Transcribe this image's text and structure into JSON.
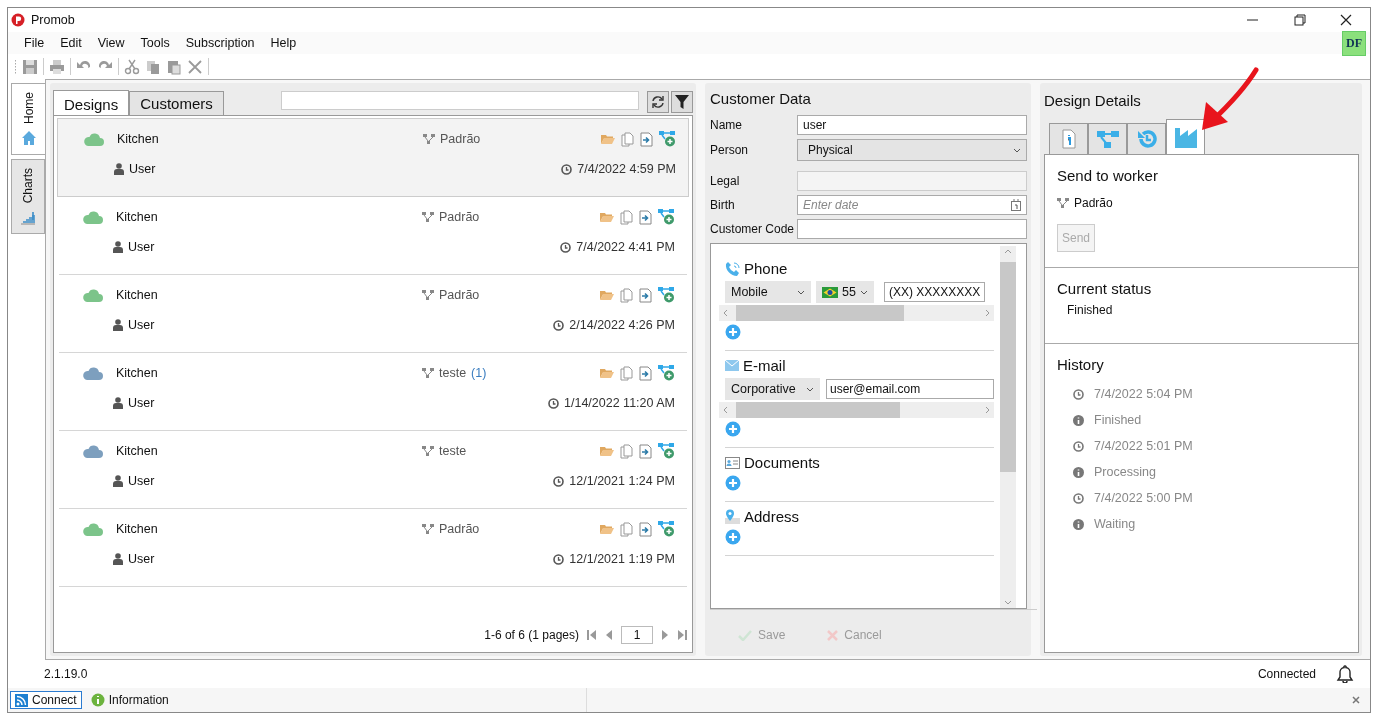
{
  "window": {
    "title": "Promob",
    "user_badge": "DF"
  },
  "menu": [
    {
      "label": "File"
    },
    {
      "label": "Edit"
    },
    {
      "label": "View"
    },
    {
      "label": "Tools"
    },
    {
      "label": "Subscription"
    },
    {
      "label": "Help"
    }
  ],
  "side_tabs": [
    {
      "label": "Home",
      "kind": "home",
      "selected": true
    },
    {
      "label": "Charts",
      "kind": "charts",
      "selected": false
    }
  ],
  "designs_panel": {
    "tabs": [
      {
        "label": "Designs",
        "selected": true
      },
      {
        "label": "Customers",
        "selected": false
      }
    ],
    "rows": [
      {
        "name": "Kitchen",
        "user": "User",
        "workflow": "Padrão",
        "date": "7/4/2022 4:59 PM",
        "color": "#7cc48a",
        "selected": true
      },
      {
        "name": "Kitchen",
        "user": "User",
        "workflow": "Padrão",
        "date": "7/4/2022 4:41 PM",
        "color": "#7cc48a",
        "selected": false
      },
      {
        "name": "Kitchen",
        "user": "User",
        "workflow": "Padrão",
        "date": "2/14/2022 4:26 PM",
        "color": "#7cc48a",
        "selected": false
      },
      {
        "name": "Kitchen",
        "user": "User",
        "workflow": "teste",
        "workflow_count": "(1)",
        "date": "1/14/2022 11:20 AM",
        "color": "#7d9fbe",
        "selected": false
      },
      {
        "name": "Kitchen",
        "user": "User",
        "workflow": "teste",
        "date": "12/1/2021 1:24 PM",
        "color": "#7d9fbe",
        "selected": false
      },
      {
        "name": "Kitchen",
        "user": "User",
        "workflow": "Padrão",
        "date": "12/1/2021 1:19 PM",
        "color": "#7cc48a",
        "selected": false
      }
    ],
    "pager": {
      "summary": "1-6 of 6 (1 pages)",
      "page": "1"
    }
  },
  "customer_data": {
    "title": "Customer Data",
    "fields": [
      {
        "label": "Name",
        "kind": "text",
        "value": "user",
        "disabled": false
      },
      {
        "label": "Person",
        "kind": "select",
        "value": "Physical",
        "disabled": false
      },
      {
        "label": "Legal",
        "kind": "text",
        "disabled": true
      },
      {
        "label": "Birth",
        "kind": "date",
        "placeholder": "Enter date",
        "disabled": false
      },
      {
        "label": "Customer Code",
        "kind": "text",
        "disabled": false
      }
    ],
    "sections": [
      {
        "kind": "phone",
        "title": "Phone",
        "type": "Mobile",
        "country_code": "55",
        "value": "(XX) XXXXXXXX"
      },
      {
        "kind": "email",
        "title": "E-mail",
        "type": "Corporative",
        "value": "user@email.com"
      },
      {
        "kind": "documents",
        "title": "Documents"
      },
      {
        "kind": "address",
        "title": "Address"
      }
    ],
    "actions": [
      {
        "label": "Save",
        "kind": "save",
        "disabled": true
      },
      {
        "label": "Cancel",
        "kind": "cancel",
        "disabled": true
      }
    ]
  },
  "design_details": {
    "title": "Design Details",
    "tabs": [
      {
        "kind": "info",
        "selected": false
      },
      {
        "kind": "workflow",
        "selected": false
      },
      {
        "kind": "history",
        "selected": false
      },
      {
        "kind": "factory",
        "selected": true
      }
    ],
    "send_to_worker": {
      "title": "Send to worker",
      "workflow": "Padrão",
      "button": {
        "label": "Send",
        "disabled": true
      }
    },
    "current_status": {
      "title": "Current status",
      "value": "Finished"
    },
    "history": {
      "title": "History",
      "entries": [
        {
          "time": "7/4/2022 5:04 PM",
          "status": "Finished"
        },
        {
          "time": "7/4/2022 5:01 PM",
          "status": "Processing"
        },
        {
          "time": "7/4/2022 5:00 PM",
          "status": "Waiting"
        }
      ]
    }
  },
  "status_bar": {
    "version": "2.1.19.0",
    "connection": "Connected"
  },
  "bottom_tabs": [
    {
      "label": "Connect",
      "kind": "connect",
      "selected": true
    },
    {
      "label": "Information",
      "kind": "information",
      "selected": false
    }
  ]
}
